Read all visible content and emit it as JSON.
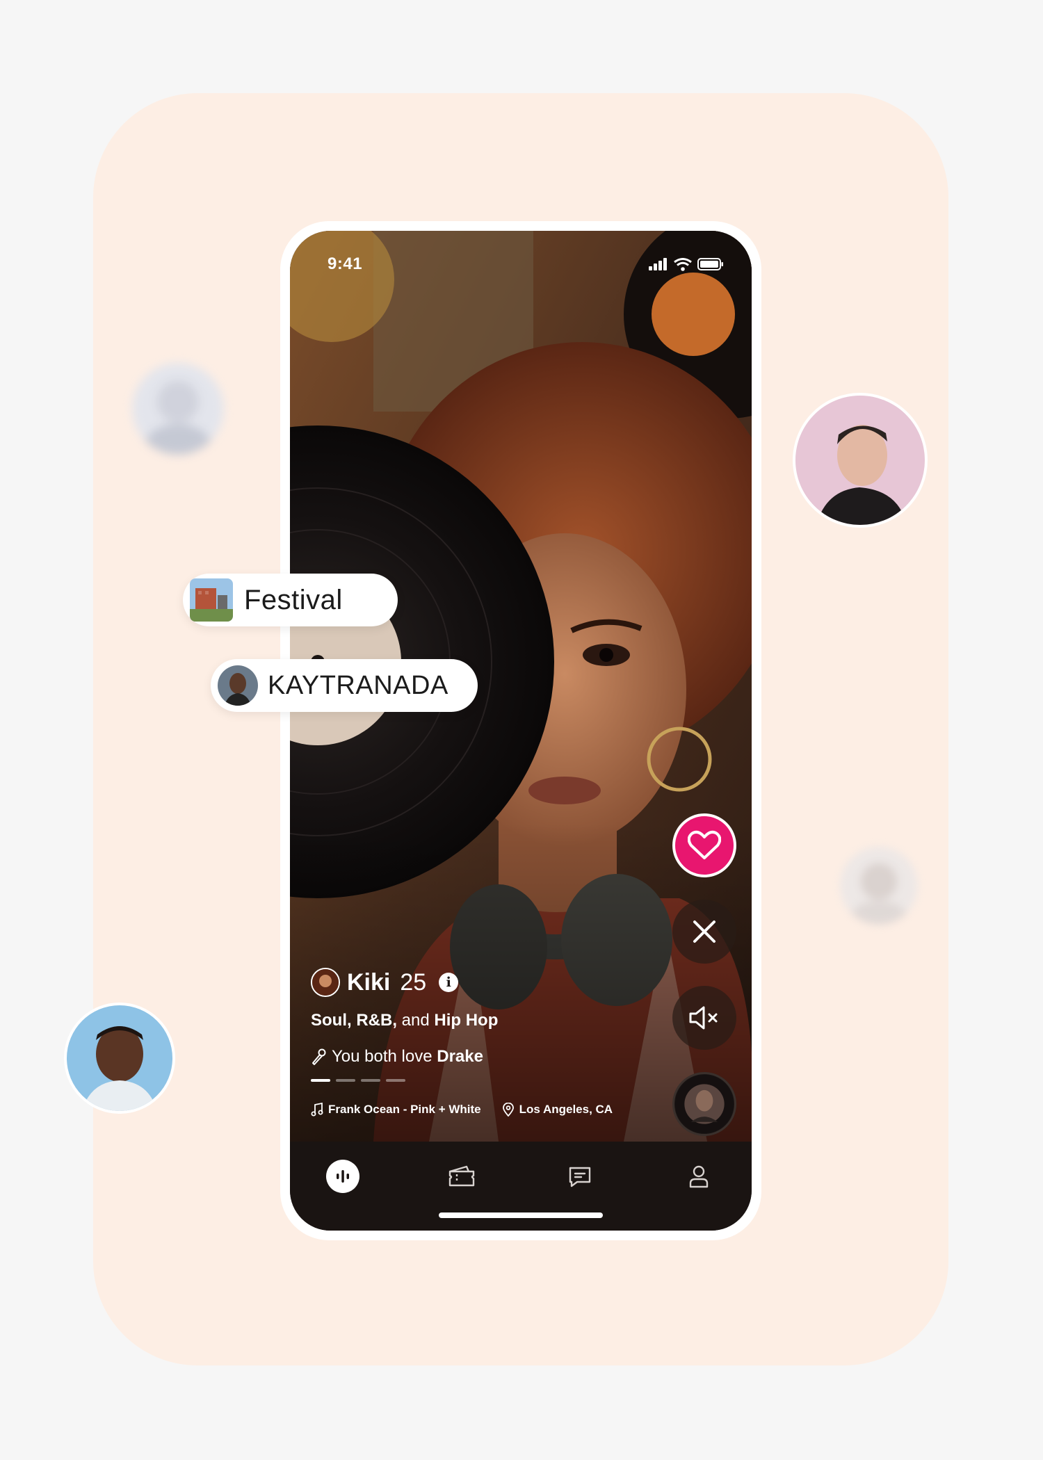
{
  "status_bar": {
    "time": "9:41"
  },
  "profile": {
    "name": "Kiki",
    "age": "25",
    "genres_bold_1": "Soul, R&B,",
    "genres_plain": " and ",
    "genres_bold_2": "Hip Hop",
    "shared_prefix": "You both love ",
    "shared_artist": "Drake",
    "song": "Frank Ocean - Pink + White",
    "location": "Los Angeles, CA",
    "progress_total": 4,
    "progress_active": 1
  },
  "chips": {
    "festival": "Festival",
    "artist": "KAYTRANADA"
  },
  "tabs": [
    {
      "icon": "audio-wave-icon",
      "active": true
    },
    {
      "icon": "ticket-icon",
      "active": false
    },
    {
      "icon": "chat-icon",
      "active": false
    },
    {
      "icon": "profile-icon",
      "active": false
    }
  ],
  "colors": {
    "like": "#e8166f",
    "backdrop": "#fdeee4",
    "page": "#f6f6f6"
  }
}
